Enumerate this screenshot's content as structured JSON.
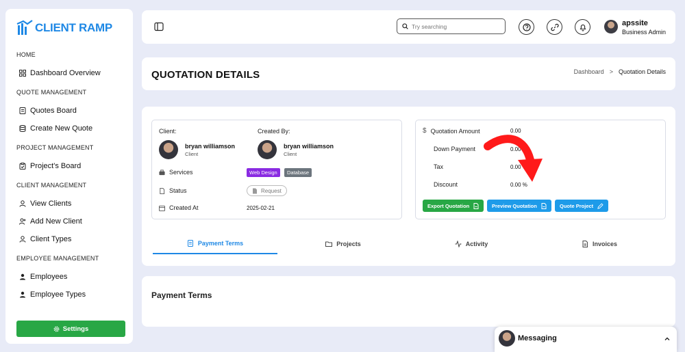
{
  "brand": {
    "name": "CLIENT RAMP",
    "color": "#1e88e5"
  },
  "sidebar": {
    "sections": [
      {
        "title": "HOME",
        "items": [
          {
            "label": "Dashboard Overview",
            "icon": "grid-icon"
          }
        ]
      },
      {
        "title": "QUOTE MANAGEMENT",
        "items": [
          {
            "label": "Quotes Board",
            "icon": "note-icon"
          },
          {
            "label": "Create New Quote",
            "icon": "database-icon"
          }
        ]
      },
      {
        "title": "PROJECT MANAGEMENT",
        "items": [
          {
            "label": "Project's Board",
            "icon": "clipboard-icon"
          }
        ]
      },
      {
        "title": "CLIENT MANAGEMENT",
        "items": [
          {
            "label": "View Clients",
            "icon": "user-icon"
          },
          {
            "label": "Add New Client",
            "icon": "user-plus-icon"
          },
          {
            "label": "Client Types",
            "icon": "user-icon"
          }
        ]
      },
      {
        "title": "EMPLOYEE MANAGEMENT",
        "items": [
          {
            "label": "Employees",
            "icon": "person-filled-icon"
          },
          {
            "label": "Employee Types",
            "icon": "person-filled-icon"
          }
        ]
      }
    ],
    "settings_label": "Settings",
    "settings_color": "#28a745"
  },
  "topbar": {
    "search_placeholder": "Try searching",
    "user": {
      "name": "apssite",
      "role": "Business Admin"
    }
  },
  "header": {
    "title": "QUOTATION DETAILS",
    "breadcrumb": {
      "parent": "Dashboard",
      "separator": ">",
      "current": "Quotation Details"
    }
  },
  "quotation": {
    "client_label": "Client:",
    "client": {
      "name": "bryan williamson",
      "role": "Client"
    },
    "created_by_label": "Created By:",
    "created_by": {
      "name": "bryan williamson",
      "role": "Client"
    },
    "services_label": "Services",
    "services": [
      {
        "label": "Web Design",
        "color": "#8a2be2"
      },
      {
        "label": "Database",
        "color": "#6c757d"
      }
    ],
    "status_label": "Status",
    "status": "Request",
    "created_at_label": "Created At",
    "created_at": "2025-02-21"
  },
  "amounts": {
    "quotation_amount_label": "Quotation Amount",
    "quotation_amount": "0.00",
    "down_payment_label": "Down Payment",
    "down_payment": "0.00 %",
    "tax_label": "Tax",
    "tax": "0.00 %",
    "discount_label": "Discount",
    "discount": "0.00 %",
    "buttons": {
      "export": {
        "label": "Export Quotation",
        "color": "#28a745"
      },
      "preview": {
        "label": "Preview Quotation",
        "color": "#1e9be9"
      },
      "quote_project": {
        "label": "Quote Project",
        "color": "#1e9be9"
      }
    }
  },
  "tabs": [
    {
      "label": "Payment Terms",
      "icon": "document-icon",
      "active": true
    },
    {
      "label": "Projects",
      "icon": "folder-icon",
      "active": false
    },
    {
      "label": "Activity",
      "icon": "activity-icon",
      "active": false
    },
    {
      "label": "Invoices",
      "icon": "file-icon",
      "active": false
    }
  ],
  "payment_terms": {
    "title": "Payment Terms"
  },
  "messaging": {
    "title": "Messaging"
  },
  "annotation": {
    "color": "#ff1a1a"
  }
}
